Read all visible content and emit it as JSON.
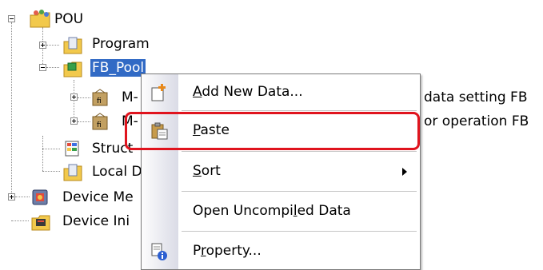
{
  "tree": {
    "pou": "POU",
    "program": "Program",
    "fb_pool": "FB_Pool",
    "fb_item1_prefix": "M-",
    "fb_item1_suffix": "data setting FB",
    "fb_item2_prefix": "M-",
    "fb_item2_suffix": "or operation FB",
    "structured": "Struct",
    "local_device": "Local D",
    "device_memory": "Device Me",
    "device_init": "Device Ini"
  },
  "menu": {
    "add_new_data": {
      "access": "A",
      "rest": "dd New Data..."
    },
    "paste": {
      "access": "P",
      "rest": "aste"
    },
    "sort": {
      "access": "S",
      "rest": "ort"
    },
    "open_uncompiled": {
      "before": "Open Uncompi",
      "access": "l",
      "after": "ed Data"
    },
    "property": {
      "before": "P",
      "access": "r",
      "after": "operty..."
    }
  },
  "colors": {
    "selection": "#316ac5",
    "highlight_box": "#e0141e",
    "menu_border": "#7a7a7a"
  },
  "icons": [
    "folder-pou-icon",
    "folder-program-icon",
    "folder-fb-pool-icon",
    "fb-item-icon",
    "structured-data-icon",
    "local-device-icon",
    "device-memory-icon",
    "device-init-icon",
    "add-new-data-icon",
    "paste-icon",
    "property-icon",
    "submenu-arrow-icon"
  ]
}
